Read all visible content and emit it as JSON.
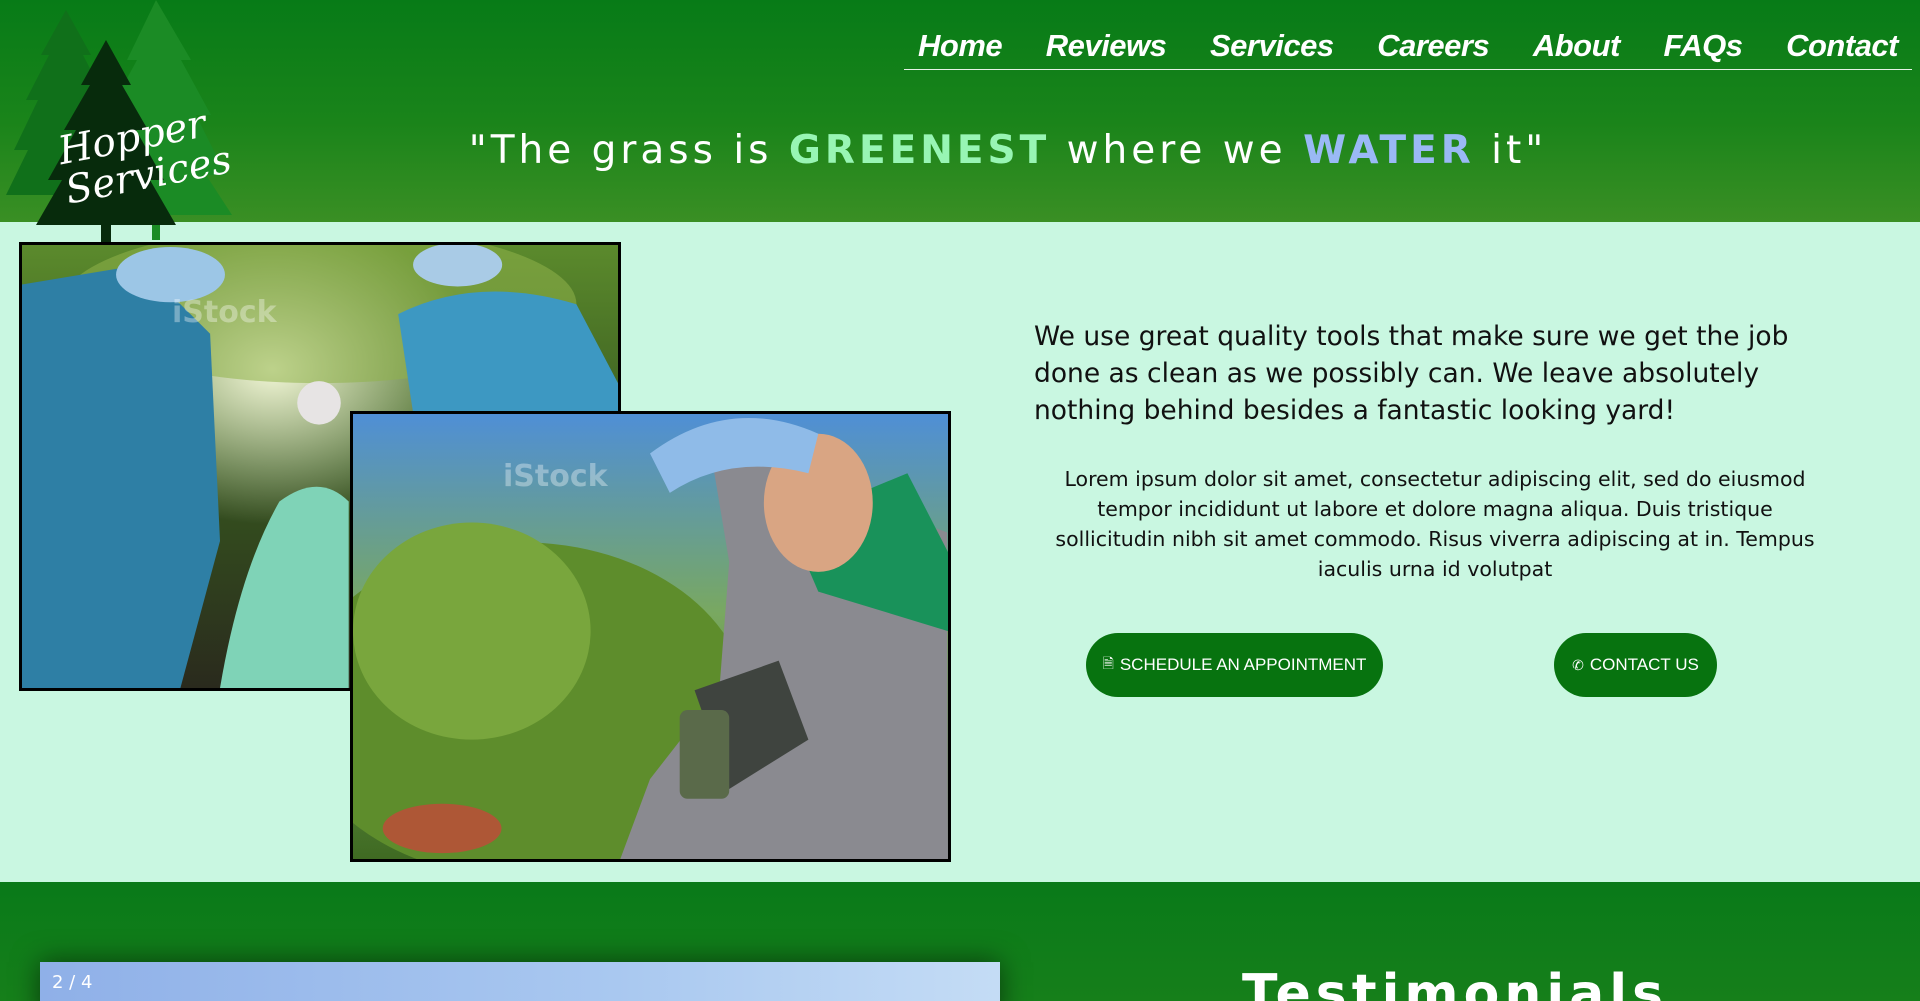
{
  "logo": {
    "line1": "Hopper",
    "line2": "Services"
  },
  "nav": [
    {
      "label": "Home"
    },
    {
      "label": "Reviews"
    },
    {
      "label": "Services"
    },
    {
      "label": "Careers"
    },
    {
      "label": "About"
    },
    {
      "label": "FAQs"
    },
    {
      "label": "Contact"
    }
  ],
  "tagline": {
    "open": "\"The grass is ",
    "green_word": "GREENEST",
    "middle": " where we ",
    "blue_word": "WATER",
    "close": " it\""
  },
  "hero": {
    "lead": "We use great quality tools that make sure we get the job done as clean as we possibly can. We leave absolutely nothing behind besides a fantastic looking yard!",
    "body": "Lorem ipsum dolor sit amet, consectetur adipiscing elit, sed do eiusmod tempor incididunt ut labore et dolore magna aliqua. Duis tristique sollicitudin nibh sit amet commodo. Risus viverra adipiscing at in. Tempus iaculis urna id volutpat",
    "schedule_label": "SCHEDULE AN APPOINTMENT",
    "contact_label": "CONTACT US",
    "photo1_watermark": "iStock",
    "photo2_watermark": "iStock"
  },
  "slider": {
    "counter": "2 / 4"
  },
  "testimonials": {
    "title": "Testimonials"
  },
  "colors": {
    "header_green": "#077b17",
    "page_bg": "#c9f7e1",
    "button_green": "#07730f",
    "accent_green": "#98f5b4",
    "accent_blue": "#9ab9f5"
  },
  "icons": {
    "schedule": "document-icon",
    "contact": "phone-icon"
  }
}
